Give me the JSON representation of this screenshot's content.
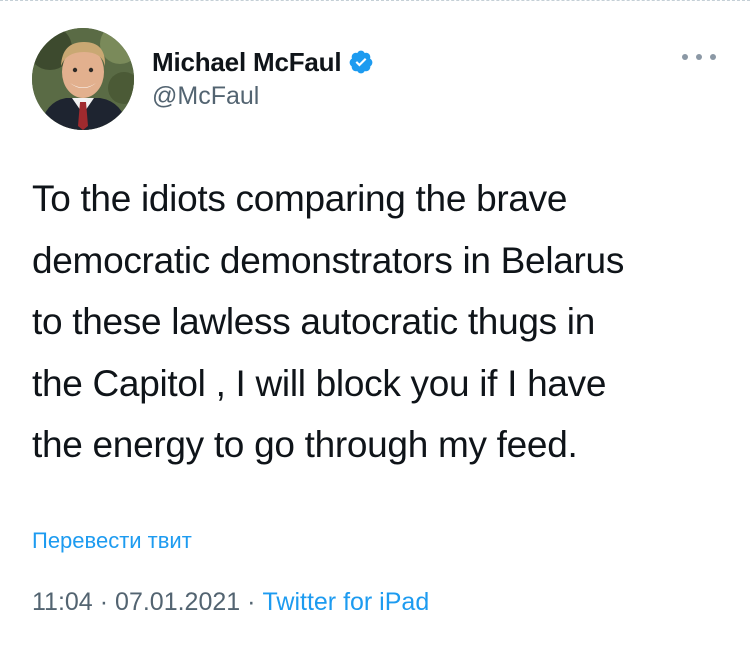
{
  "author": {
    "display_name": "Michael McFaul",
    "handle": "@McFaul",
    "verified": true
  },
  "tweet": {
    "text": "To the idiots comparing the brave\ndemocratic demonstrators in Belarus\nto these lawless autocratic thugs in\nthe Capitol , I will block you if I have\nthe energy to go through my feed."
  },
  "translate_label": "Перевести твит",
  "meta": {
    "time": "11:04",
    "date": "07.01.2021",
    "separator": "·",
    "source": "Twitter for iPad"
  },
  "colors": {
    "link": "#1d9bf0",
    "secondary": "#536471",
    "text": "#0f1419"
  }
}
